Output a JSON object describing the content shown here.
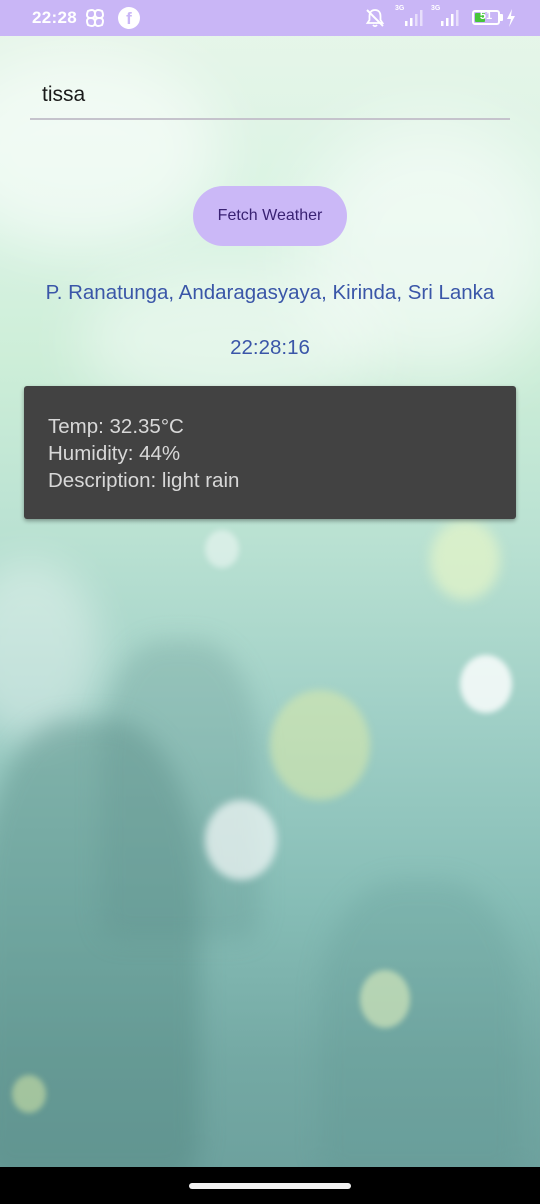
{
  "status_bar": {
    "time": "22:28",
    "network_1": "3G",
    "network_2": "3G",
    "battery_level": "51",
    "battery_fraction": 0.51,
    "icons": [
      "grid-app-icon",
      "facebook-icon",
      "mute-icon",
      "signal-icon",
      "signal-icon",
      "battery-icon",
      "charging-icon"
    ]
  },
  "search": {
    "value": "tissa"
  },
  "fetch_button": {
    "label": "Fetch Weather"
  },
  "location": {
    "text": "P. Ranatunga, Andaragasyaya, Kirinda, Sri Lanka"
  },
  "clock": {
    "time": "22:28:16"
  },
  "weather": {
    "temp": "Temp: 32.35°C",
    "humidity": "Humidity: 44%",
    "description": "Description: light rain"
  },
  "colors": {
    "status_bar": "#c9b6f6",
    "button": "#cbb8f7",
    "button_text": "#3a2273",
    "accent_text": "#3a56a8",
    "card": "#424242",
    "card_text": "#d8d8d8"
  }
}
